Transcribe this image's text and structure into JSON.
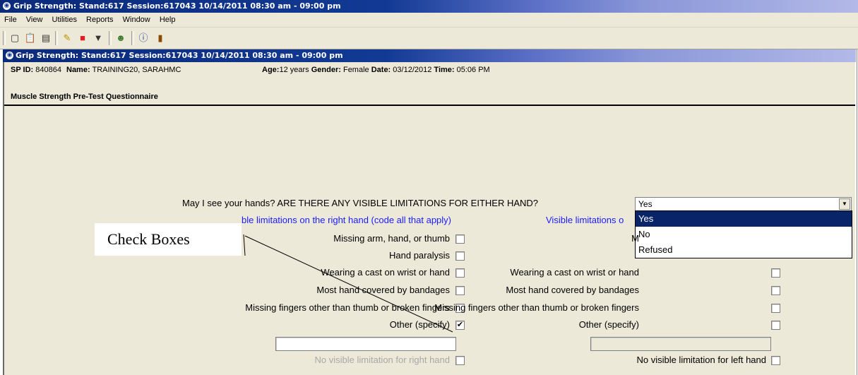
{
  "app": {
    "window_title": "Grip Strength: Stand:617 Session:617043 10/14/2011 08:30 am - 09:00 pm",
    "inner_title": "Grip Strength: Stand:617 Session:617043 10/14/2011 08:30 am - 09:00 pm",
    "brand_blue": "#123a94"
  },
  "menu": [
    "File",
    "View",
    "Utilities",
    "Reports",
    "Window",
    "Help"
  ],
  "toolbar": {
    "icons": [
      "new-icon",
      "clipboard-icon",
      "inbox-icon",
      "edit-icon",
      "stop-icon",
      "filter-icon",
      "person-icon",
      "help-icon",
      "exit-icon"
    ]
  },
  "participant": {
    "sp_label": "SP ID:",
    "sp_id": "840864",
    "name_label": "Name:",
    "name": "TRAINING20, SARAHMC",
    "age_label": "Age:",
    "age": "12 years",
    "gender_label": "Gender:",
    "gender": "Female",
    "date_label": "Date:",
    "date": "03/12/2012",
    "time_label": "Time:",
    "time": "05:06 PM"
  },
  "section": {
    "title": "Muscle Strength Pre-Test Questionnaire"
  },
  "question": {
    "text": "May I see your hands? ARE THERE ANY VISIBLE LIMITATIONS FOR EITHER HAND?",
    "selected": "Yes",
    "options": [
      "Yes",
      "No",
      "Refused"
    ]
  },
  "right_hand": {
    "heading": "ble limitations on the right hand (code all that apply)",
    "items": [
      {
        "label": "Missing arm, hand, or thumb",
        "checked": false
      },
      {
        "label": "Hand paralysis",
        "checked": false
      },
      {
        "label": "Wearing a cast on wrist or hand",
        "checked": false
      },
      {
        "label": "Most hand covered by bandages",
        "checked": false
      },
      {
        "label": "Missing fingers other than thumb or broken fingers",
        "checked": false
      },
      {
        "label": "Other (specify)",
        "checked": true
      }
    ],
    "specify_value": "",
    "no_limitation": {
      "label": "No visible limitation for right hand",
      "checked": false
    }
  },
  "left_hand": {
    "heading": "Visible limitations o",
    "items": [
      {
        "label": "M",
        "checked": false
      },
      {
        "label": "",
        "checked": false
      },
      {
        "label": "Wearing a cast on wrist or hand",
        "checked": false
      },
      {
        "label": "Most hand covered by bandages",
        "checked": false
      },
      {
        "label": "Missing fingers other than thumb or broken fingers",
        "checked": false
      },
      {
        "label": "Other (specify)",
        "checked": false
      }
    ],
    "specify_value": "",
    "no_limitation": {
      "label": "No visible limitation for left hand",
      "checked": false
    }
  },
  "annotation": {
    "callout_text": "Check Boxes"
  }
}
